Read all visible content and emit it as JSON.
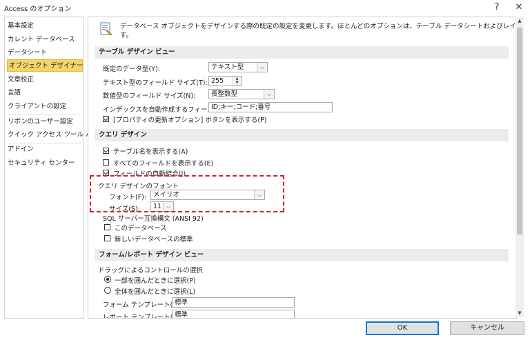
{
  "window": {
    "title": "Access のオプション",
    "help_glyph": "?",
    "close_glyph": "✕"
  },
  "sidebar": {
    "items": [
      {
        "label": "基本設定"
      },
      {
        "label": "カレント データベース"
      },
      {
        "label": "データシート"
      },
      {
        "label": "オブジェクト デザイナー",
        "selected": true
      },
      {
        "label": "文章校正"
      },
      {
        "label": "言語"
      },
      {
        "label": "クライアントの設定"
      },
      {
        "label": "リボンのユーザー設定"
      },
      {
        "label": "クイック アクセス ツール バー"
      },
      {
        "label": "アドイン"
      },
      {
        "label": "セキュリティ センター"
      }
    ]
  },
  "intro": {
    "text_line1": "データベース オブジェクトをデザインする際の既定の設定を変更します。ほとんどのオプションは、テーブル データシートおよびレイアウト ビューでは無視されま",
    "text_line2": "す。",
    "icon": "design-options-icon"
  },
  "table_design": {
    "header": "テーブル デザイン ビュー",
    "default_type_label": "既定のデータ型(Y):",
    "default_type_value": "テキスト型",
    "text_size_label": "テキスト型のフィールド サイズ(T):",
    "text_size_value": "255",
    "number_size_label": "数値型のフィールド サイズ(N):",
    "number_size_value": "長整数型",
    "autoindex_label": "インデックスを自動作成するフィールド(I):",
    "autoindex_value": "ID;キー;コード;番号",
    "show_property_update_label": "[プロパティの更新オプション] ボタンを表示する(P)",
    "show_property_update_checked": true
  },
  "query_design": {
    "header": "クエリ デザイン",
    "show_table_names_label": "テーブル名を表示する(A)",
    "show_table_names_checked": true,
    "output_all_fields_label": "すべてのフィールドを表示する(E)",
    "output_all_fields_checked": false,
    "autojoin_label": "フィールドの自動結合(J)",
    "autojoin_checked": true,
    "font_group_label": "クエリ デザインのフォント",
    "font_label": "フォント(F):",
    "font_value": "メイリオ",
    "size_label": "サイズ(S):",
    "size_value": "11",
    "sql_compat_label": "SQL サーバー互換構文 (ANSI 92)",
    "this_db_label": "このデータベース",
    "this_db_checked": false,
    "new_db_label": "新しいデータベースの標準",
    "new_db_checked": false
  },
  "form_report": {
    "header": "フォーム/レポート デザイン ビュー",
    "selection_group_label": "ドラッグによるコントロールの選択",
    "partial_label": "一部を囲んだときに選択(P)",
    "partial_checked": true,
    "full_label": "全体を囲んだときに選択(L)",
    "full_checked": false,
    "form_template_label": "フォーム テンプレート(M):",
    "form_template_value": "標準",
    "report_template_label": "レポート テンプレート(R):",
    "report_template_value": "標準"
  },
  "buttons": {
    "ok": "OK",
    "cancel": "キャンセル"
  },
  "colors": {
    "selected_bg": "#f5d56a",
    "highlight_border": "#d51f2a",
    "section_bg": "#ececec"
  }
}
